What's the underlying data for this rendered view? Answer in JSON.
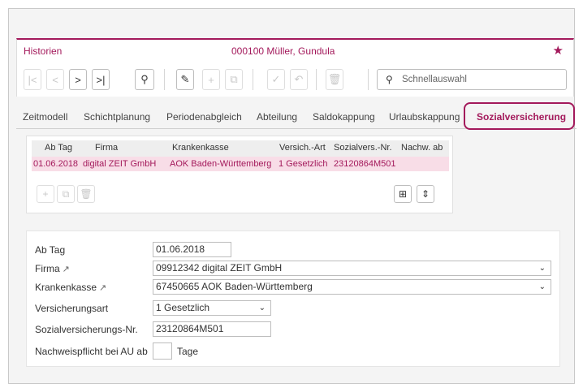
{
  "header": {
    "title": "Historien",
    "record": "000100  Müller, Gundula",
    "star_icon": "star-add-icon"
  },
  "toolbar": {
    "first_label": "|<",
    "prev_label": "<",
    "next_label": ">",
    "last_label": ">|",
    "search_label": "🔍",
    "edit_label": "✎",
    "add_label": "+",
    "copy_label": "⧉",
    "confirm_label": "✓",
    "undo_label": "↶",
    "delete_label": "🗑",
    "quick_search_placeholder": "Schnellauswahl"
  },
  "tabs": [
    {
      "label": "Zeitmodell"
    },
    {
      "label": "Schichtplanung"
    },
    {
      "label": "Periodenabgleich"
    },
    {
      "label": "Abteilung"
    },
    {
      "label": "Saldokappung"
    },
    {
      "label": "Urlaubskappung"
    },
    {
      "label": "Sozialversicherung"
    }
  ],
  "grid": {
    "columns": [
      "Ab Tag",
      "Firma",
      "Krankenkasse",
      "Versich.-Art",
      "Sozialvers.-Nr.",
      "Nachw. ab"
    ],
    "rows": [
      [
        "01.06.2018",
        "digital ZEIT GmbH",
        "AOK Baden-Württemberg",
        "1 Gesetzlich",
        "23120864M501",
        ""
      ]
    ],
    "buttons": {
      "add": "+",
      "copy": "⧉",
      "delete": "🗑",
      "layout": "⊞",
      "sort": "⇕"
    }
  },
  "form": {
    "ab_tag_label": "Ab Tag",
    "ab_tag_value": "01.06.2018",
    "firma_label": "Firma",
    "firma_value": "09912342 digital ZEIT GmbH",
    "kasse_label": "Krankenkasse",
    "kasse_value": "67450665 AOK Baden-Württemberg",
    "art_label": "Versicherungsart",
    "art_value": "1 Gesetzlich",
    "svnr_label": "Sozialversicherungs-Nr.",
    "svnr_value": "23120864M501",
    "nachweis_label": "Nachweispflicht bei AU ab",
    "nachweis_value": "",
    "nachweis_unit": "Tage",
    "ext_icon": "↗"
  },
  "colors": {
    "accent": "#a3195b",
    "row_highlight": "#f8dde7"
  }
}
